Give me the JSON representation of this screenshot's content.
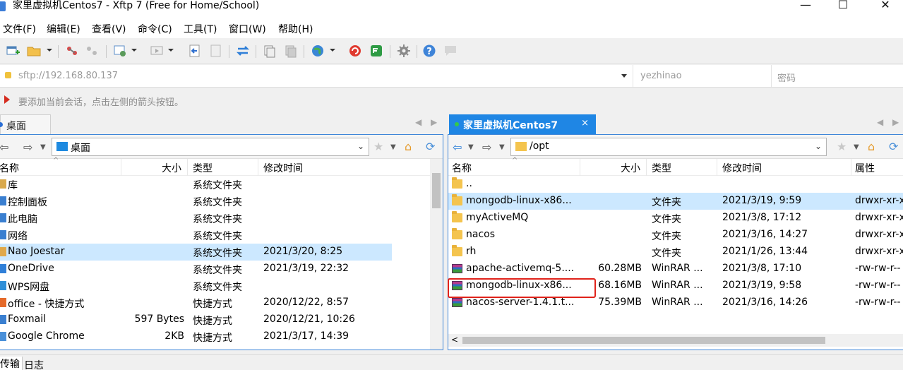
{
  "window": {
    "title": "家里虚拟机Centos7 - Xftp 7 (Free for Home/School)",
    "minimize": "—",
    "maximize": "☐",
    "close": "✕"
  },
  "menu": [
    "文件(F)",
    "编辑(E)",
    "查看(V)",
    "命令(C)",
    "工具(T)",
    "窗口(W)",
    "帮助(H)"
  ],
  "address": {
    "url": "sftp://192.168.80.137",
    "user_placeholder": "yezhinao",
    "password_placeholder": "密码"
  },
  "hint": "要添加当前会话，点击左侧的箭头按钮。",
  "left": {
    "tab": "桌面",
    "path": "桌面",
    "columns": [
      "名称",
      "大小",
      "类型",
      "修改时间"
    ],
    "rows": [
      {
        "name": "库",
        "size": "",
        "type": "系统文件夹",
        "modified": ""
      },
      {
        "name": "控制面板",
        "size": "",
        "type": "系统文件夹",
        "modified": ""
      },
      {
        "name": "此电脑",
        "size": "",
        "type": "系统文件夹",
        "modified": ""
      },
      {
        "name": "网络",
        "size": "",
        "type": "系统文件夹",
        "modified": ""
      },
      {
        "name": "Nao Joestar",
        "size": "",
        "type": "系统文件夹",
        "modified": "2021/3/20, 8:25",
        "selected": true
      },
      {
        "name": "OneDrive",
        "size": "",
        "type": "系统文件夹",
        "modified": "2021/3/19, 22:32"
      },
      {
        "name": "WPS网盘",
        "size": "",
        "type": "系统文件夹",
        "modified": ""
      },
      {
        "name": "office - 快捷方式",
        "size": "",
        "type": "快捷方式",
        "modified": "2020/12/22, 8:57"
      },
      {
        "name": "Foxmail",
        "size": "597 Bytes",
        "type": "快捷方式",
        "modified": "2020/12/21, 10:26"
      },
      {
        "name": "Google Chrome",
        "size": "2KB",
        "type": "快捷方式",
        "modified": "2021/3/17, 14:39"
      }
    ]
  },
  "right": {
    "tab": "家里虚拟机Centos7",
    "tab_close": "×",
    "path": "/opt",
    "columns": [
      "名称",
      "大小",
      "类型",
      "修改时间",
      "属性"
    ],
    "rows": [
      {
        "name": "..",
        "size": "",
        "type": "",
        "modified": "",
        "attr": "",
        "icon": "folder"
      },
      {
        "name": "mongodb-linux-x86...",
        "size": "",
        "type": "文件夹",
        "modified": "2021/3/19, 9:59",
        "attr": "drwxr-xr-x",
        "icon": "folder",
        "selected": true
      },
      {
        "name": "myActiveMQ",
        "size": "",
        "type": "文件夹",
        "modified": "2021/3/8, 17:12",
        "attr": "drwxr-xr-x",
        "icon": "folder"
      },
      {
        "name": "nacos",
        "size": "",
        "type": "文件夹",
        "modified": "2021/3/16, 14:27",
        "attr": "drwxr-xr-x",
        "icon": "folder"
      },
      {
        "name": "rh",
        "size": "",
        "type": "文件夹",
        "modified": "2021/1/26, 13:44",
        "attr": "drwxr-xr-x",
        "icon": "folder"
      },
      {
        "name": "apache-activemq-5....",
        "size": "60.28MB",
        "type": "WinRAR ...",
        "modified": "2021/3/8, 17:10",
        "attr": "-rw-rw-r--",
        "icon": "rar"
      },
      {
        "name": "mongodb-linux-x86...",
        "size": "68.16MB",
        "type": "WinRAR ...",
        "modified": "2021/3/19, 9:58",
        "attr": "-rw-rw-r--",
        "icon": "rar"
      },
      {
        "name": "nacos-server-1.4.1.t...",
        "size": "75.39MB",
        "type": "WinRAR ...",
        "modified": "2021/3/16, 14:26",
        "attr": "-rw-rw-r--",
        "icon": "rar"
      }
    ]
  },
  "bottom_tabs": [
    "传输",
    "日志"
  ],
  "colors": {
    "accent": "#1f86e4",
    "selection": "#cce8ff",
    "highlight_box": "#e0231b"
  }
}
